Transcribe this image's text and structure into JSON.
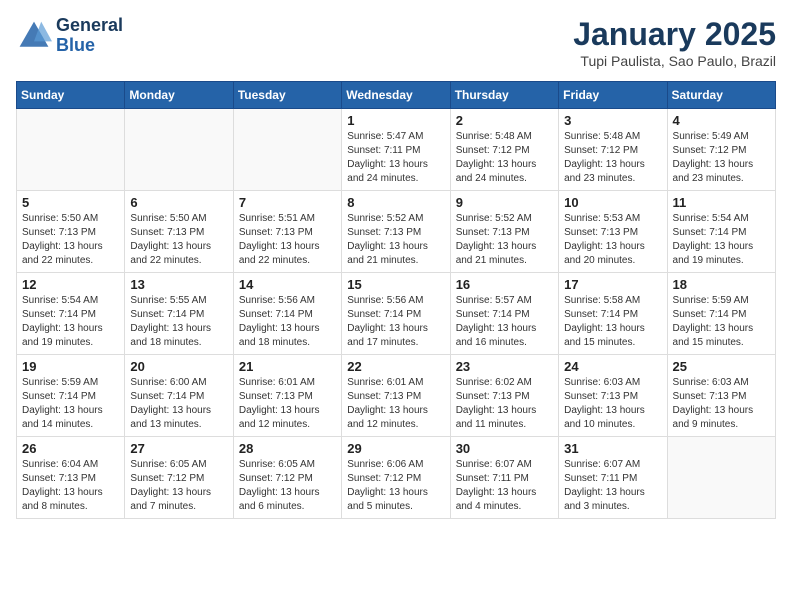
{
  "header": {
    "logo_line1": "General",
    "logo_line2": "Blue",
    "month": "January 2025",
    "location": "Tupi Paulista, Sao Paulo, Brazil"
  },
  "days_of_week": [
    "Sunday",
    "Monday",
    "Tuesday",
    "Wednesday",
    "Thursday",
    "Friday",
    "Saturday"
  ],
  "weeks": [
    [
      {
        "day": "",
        "info": ""
      },
      {
        "day": "",
        "info": ""
      },
      {
        "day": "",
        "info": ""
      },
      {
        "day": "1",
        "info": "Sunrise: 5:47 AM\nSunset: 7:11 PM\nDaylight: 13 hours\nand 24 minutes."
      },
      {
        "day": "2",
        "info": "Sunrise: 5:48 AM\nSunset: 7:12 PM\nDaylight: 13 hours\nand 24 minutes."
      },
      {
        "day": "3",
        "info": "Sunrise: 5:48 AM\nSunset: 7:12 PM\nDaylight: 13 hours\nand 23 minutes."
      },
      {
        "day": "4",
        "info": "Sunrise: 5:49 AM\nSunset: 7:12 PM\nDaylight: 13 hours\nand 23 minutes."
      }
    ],
    [
      {
        "day": "5",
        "info": "Sunrise: 5:50 AM\nSunset: 7:13 PM\nDaylight: 13 hours\nand 22 minutes."
      },
      {
        "day": "6",
        "info": "Sunrise: 5:50 AM\nSunset: 7:13 PM\nDaylight: 13 hours\nand 22 minutes."
      },
      {
        "day": "7",
        "info": "Sunrise: 5:51 AM\nSunset: 7:13 PM\nDaylight: 13 hours\nand 22 minutes."
      },
      {
        "day": "8",
        "info": "Sunrise: 5:52 AM\nSunset: 7:13 PM\nDaylight: 13 hours\nand 21 minutes."
      },
      {
        "day": "9",
        "info": "Sunrise: 5:52 AM\nSunset: 7:13 PM\nDaylight: 13 hours\nand 21 minutes."
      },
      {
        "day": "10",
        "info": "Sunrise: 5:53 AM\nSunset: 7:13 PM\nDaylight: 13 hours\nand 20 minutes."
      },
      {
        "day": "11",
        "info": "Sunrise: 5:54 AM\nSunset: 7:14 PM\nDaylight: 13 hours\nand 19 minutes."
      }
    ],
    [
      {
        "day": "12",
        "info": "Sunrise: 5:54 AM\nSunset: 7:14 PM\nDaylight: 13 hours\nand 19 minutes."
      },
      {
        "day": "13",
        "info": "Sunrise: 5:55 AM\nSunset: 7:14 PM\nDaylight: 13 hours\nand 18 minutes."
      },
      {
        "day": "14",
        "info": "Sunrise: 5:56 AM\nSunset: 7:14 PM\nDaylight: 13 hours\nand 18 minutes."
      },
      {
        "day": "15",
        "info": "Sunrise: 5:56 AM\nSunset: 7:14 PM\nDaylight: 13 hours\nand 17 minutes."
      },
      {
        "day": "16",
        "info": "Sunrise: 5:57 AM\nSunset: 7:14 PM\nDaylight: 13 hours\nand 16 minutes."
      },
      {
        "day": "17",
        "info": "Sunrise: 5:58 AM\nSunset: 7:14 PM\nDaylight: 13 hours\nand 15 minutes."
      },
      {
        "day": "18",
        "info": "Sunrise: 5:59 AM\nSunset: 7:14 PM\nDaylight: 13 hours\nand 15 minutes."
      }
    ],
    [
      {
        "day": "19",
        "info": "Sunrise: 5:59 AM\nSunset: 7:14 PM\nDaylight: 13 hours\nand 14 minutes."
      },
      {
        "day": "20",
        "info": "Sunrise: 6:00 AM\nSunset: 7:14 PM\nDaylight: 13 hours\nand 13 minutes."
      },
      {
        "day": "21",
        "info": "Sunrise: 6:01 AM\nSunset: 7:13 PM\nDaylight: 13 hours\nand 12 minutes."
      },
      {
        "day": "22",
        "info": "Sunrise: 6:01 AM\nSunset: 7:13 PM\nDaylight: 13 hours\nand 12 minutes."
      },
      {
        "day": "23",
        "info": "Sunrise: 6:02 AM\nSunset: 7:13 PM\nDaylight: 13 hours\nand 11 minutes."
      },
      {
        "day": "24",
        "info": "Sunrise: 6:03 AM\nSunset: 7:13 PM\nDaylight: 13 hours\nand 10 minutes."
      },
      {
        "day": "25",
        "info": "Sunrise: 6:03 AM\nSunset: 7:13 PM\nDaylight: 13 hours\nand 9 minutes."
      }
    ],
    [
      {
        "day": "26",
        "info": "Sunrise: 6:04 AM\nSunset: 7:13 PM\nDaylight: 13 hours\nand 8 minutes."
      },
      {
        "day": "27",
        "info": "Sunrise: 6:05 AM\nSunset: 7:12 PM\nDaylight: 13 hours\nand 7 minutes."
      },
      {
        "day": "28",
        "info": "Sunrise: 6:05 AM\nSunset: 7:12 PM\nDaylight: 13 hours\nand 6 minutes."
      },
      {
        "day": "29",
        "info": "Sunrise: 6:06 AM\nSunset: 7:12 PM\nDaylight: 13 hours\nand 5 minutes."
      },
      {
        "day": "30",
        "info": "Sunrise: 6:07 AM\nSunset: 7:11 PM\nDaylight: 13 hours\nand 4 minutes."
      },
      {
        "day": "31",
        "info": "Sunrise: 6:07 AM\nSunset: 7:11 PM\nDaylight: 13 hours\nand 3 minutes."
      },
      {
        "day": "",
        "info": ""
      }
    ]
  ]
}
